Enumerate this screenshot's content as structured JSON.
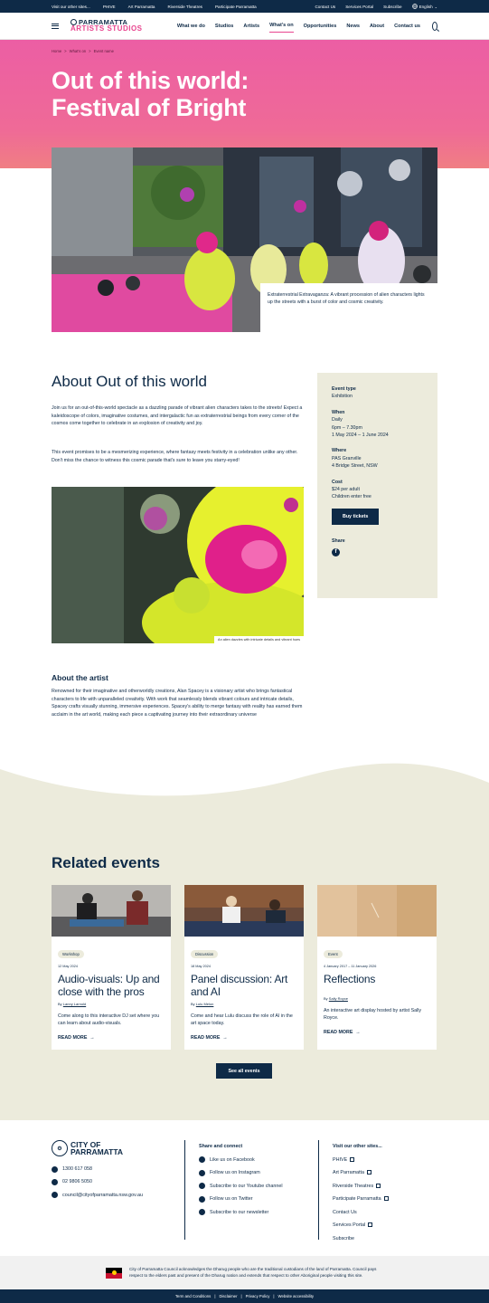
{
  "utility": {
    "left": [
      "Visit our other sites...",
      "PHIVE",
      "Art Parramatta",
      "Riverside Theatres",
      "Participate Parramatta"
    ],
    "right": [
      "Contact Us",
      "Services Portal",
      "Subscribe"
    ],
    "language": "English"
  },
  "header": {
    "logo_line1": "PARRAMATTA",
    "logo_line2": "ARTISTS STUDIOS",
    "nav": [
      "What we do",
      "Studios",
      "Artists",
      "What's on",
      "Opportunities",
      "News",
      "About",
      "Contact us"
    ],
    "active_nav": "What's on"
  },
  "hero": {
    "breadcrumb": [
      "Home",
      ">",
      "What's on",
      ">",
      "Event name"
    ],
    "title": "Out of this world: Festival of Bright",
    "image_caption": "Extraterrestrial Extravaganza: A vibrant procession of alien characters lights up the streets with a burst of color and cosmic creativity."
  },
  "about": {
    "heading": "About Out of this world",
    "para1": "Join us for an out-of-this-world spectacle as a dazzling parade of vibrant alien characters takes to the streets! Expect a kaleidoscope of colors, imaginative costumes, and intergalactic fun as extraterrestrial beings from every corner of the cosmos come together to celebrate in an explosion of creativity and joy.",
    "para2": "This event promises to be a mesmerizing experience, where fantasy meets festivity in a celebration unlike any other. Don't miss the chance to witness this cosmic parade that's sure to leave you starry-eyed!",
    "image_caption": "An alien dazzles with intricate details and vibrant hues",
    "artist_heading": "About the artist",
    "artist_text": "Renowned for their imaginative and otherworldly creations, Alan Spacey is a visionary artist who brings fantastical characters to life with unparalleled creativity. With work that seamlessly blends vibrant colours and intricate details, Spacey crafts visually stunning, immersive experiences. Spacey's ability to merge fantasy with reality has earned them acclaim in the art world, making each piece a captivating journey into their extraordinary universe"
  },
  "sidebar": {
    "type_label": "Event type",
    "type_value": "Exhibition",
    "when_label": "When",
    "when_1": "Daily",
    "when_2": "6pm – 7.30pm",
    "when_3": "1 May 2024 – 1 June 2024",
    "where_label": "Where",
    "where_1": "PAS Granville",
    "where_2": "4 Bridge Street, NSW",
    "cost_label": "Cost",
    "cost_1": "$24 per adult",
    "cost_2": "Children enter free",
    "button": "Buy tickets",
    "share_label": "Share"
  },
  "related": {
    "heading": "Related events",
    "see_all": "See all events",
    "read_more": "READ MORE",
    "by": "By",
    "cards": [
      {
        "tag": "Workshop",
        "date": "12 May 2024",
        "title": "Audio-visuals: Up and close with the pros",
        "author": "Lanny Larnold",
        "desc": "Come along to this interactive DJ set where you can learn about audio-visuals."
      },
      {
        "tag": "Discussion",
        "date": "18 May 2024",
        "title": "Panel discussion: Art and AI",
        "author": "Lulu Melon",
        "desc": "Come and hear Lulu discuss the role of AI in the art space today."
      },
      {
        "tag": "Event",
        "date": "4 January 2017 – 11 January 2026",
        "title": "Reflections",
        "author": "Sally Royce",
        "desc": "An interactive art display hosted by artist Sally Royce."
      }
    ]
  },
  "footer": {
    "logo_1": "CITY OF",
    "logo_2": "PARRAMATTA",
    "phone1": "1300 617 058",
    "phone2": "02 9806 5050",
    "email": "council@cityofparramatta.nsw.gov.au",
    "share_heading": "Share and connect",
    "share_links": [
      "Like us on Facebook",
      "Follow us on Instagram",
      "Subscribe to our Youtube channel",
      "Follow us on Twitter",
      "Subscribe to our newsletter"
    ],
    "sites_heading": "Visit our other sites...",
    "sites": [
      "PHIVE",
      "Art Parramatta",
      "Riverside Theatres",
      "Participate Parramatta",
      "Contact Us",
      "Services Portal",
      "Subscribe"
    ],
    "acknowledgement": "City of Parramatta Council acknowledges the Dharug people who are the traditional custodians of the land of Parramatta. Council pays respect to the elders past and present of the Dharug nation and extends that respect to other Aboriginal people visiting this site.",
    "legal": [
      "Term and Conditions",
      "|",
      "Disclaimer",
      "|",
      "Privacy Policy",
      "|",
      "Website accessibility"
    ]
  }
}
